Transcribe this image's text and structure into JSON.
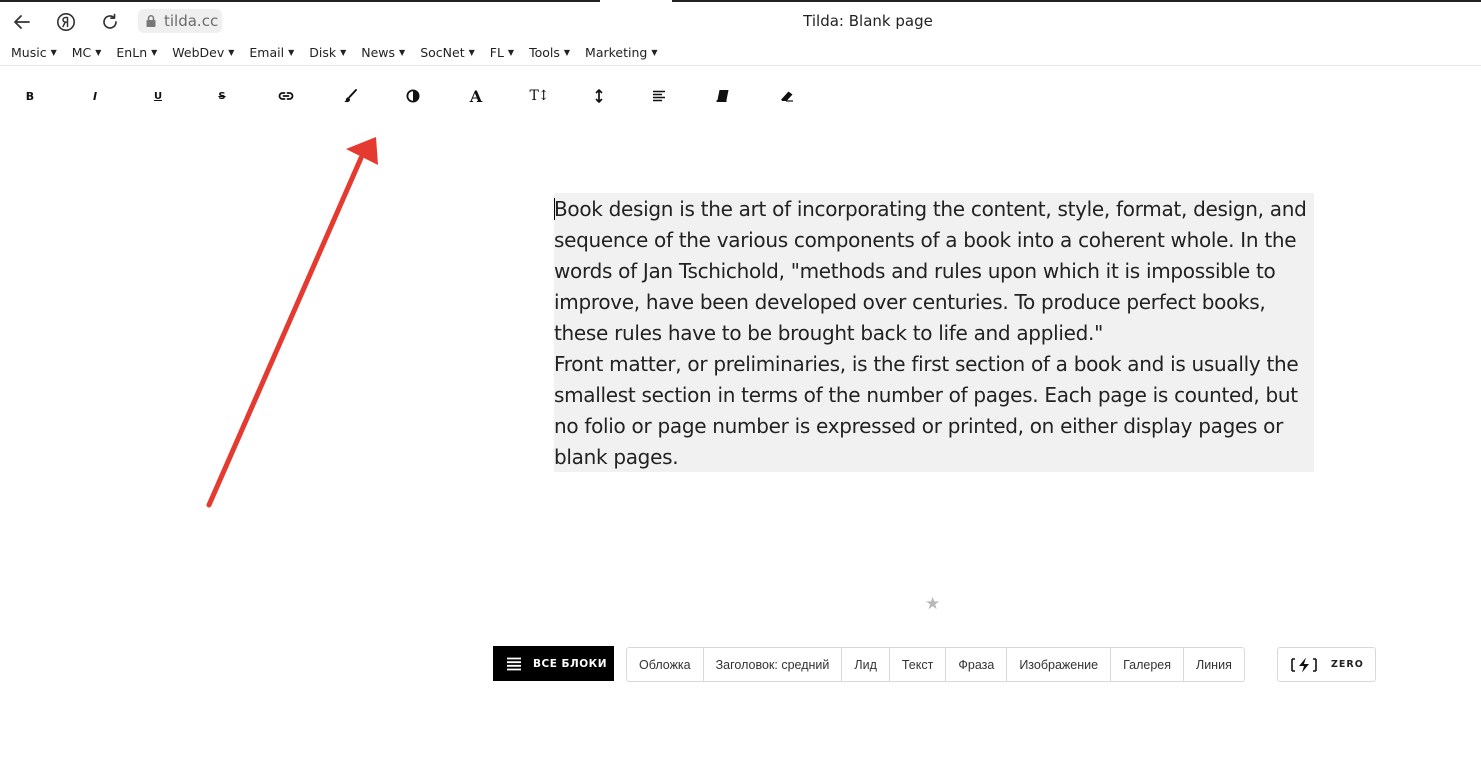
{
  "browser": {
    "url": "tilda.cc",
    "title": "Tilda: Blank page",
    "icons": [
      "back-arrow-icon",
      "yandex-icon",
      "reload-icon",
      "lock-icon"
    ]
  },
  "bookmarks": [
    {
      "label": "Music"
    },
    {
      "label": "MC"
    },
    {
      "label": "EnLn"
    },
    {
      "label": "WebDev"
    },
    {
      "label": "Email"
    },
    {
      "label": "Disk"
    },
    {
      "label": "News"
    },
    {
      "label": "SocNet"
    },
    {
      "label": "FL"
    },
    {
      "label": "Tools"
    },
    {
      "label": "Marketing"
    }
  ],
  "bookmark_caret": "▼",
  "toolbar": {
    "bold": "B",
    "italic": "I",
    "underline": "U",
    "strike": "S",
    "font": "A",
    "size": "T↕",
    "icons": [
      "link-icon",
      "brush-icon",
      "contrast-icon",
      "line-height-icon",
      "align-icon",
      "book-icon",
      "eraser-icon"
    ]
  },
  "text": {
    "p1": "Book design is the art of incorporating the content, style, format, design, and sequence of the various components of a book into a coherent whole. In the words of Jan Tschichold, \"methods and rules upon which it is impossible to improve, have been developed over centuries. To produce perfect books, these rules have to be brought back to life and applied.\"",
    "p2": "Front matter, or preliminaries, is the first section of a book and is usually the smallest section in terms of the number of pages. Each page is counted, but no folio or page number is expressed or printed, on either display pages or blank pages."
  },
  "star": "★",
  "blocks_bar": {
    "all_blocks_label": "ВСЕ БЛОКИ",
    "chips": [
      "Обложка",
      "Заголовок: средний",
      "Лид",
      "Текст",
      "Фраза",
      "Изображение",
      "Галерея",
      "Линия"
    ],
    "zero_label": "ZERO"
  },
  "colors": {
    "arrow": "#e53a2f",
    "text_block_bg": "#f1f1f1",
    "all_blocks_bg": "#000000"
  }
}
